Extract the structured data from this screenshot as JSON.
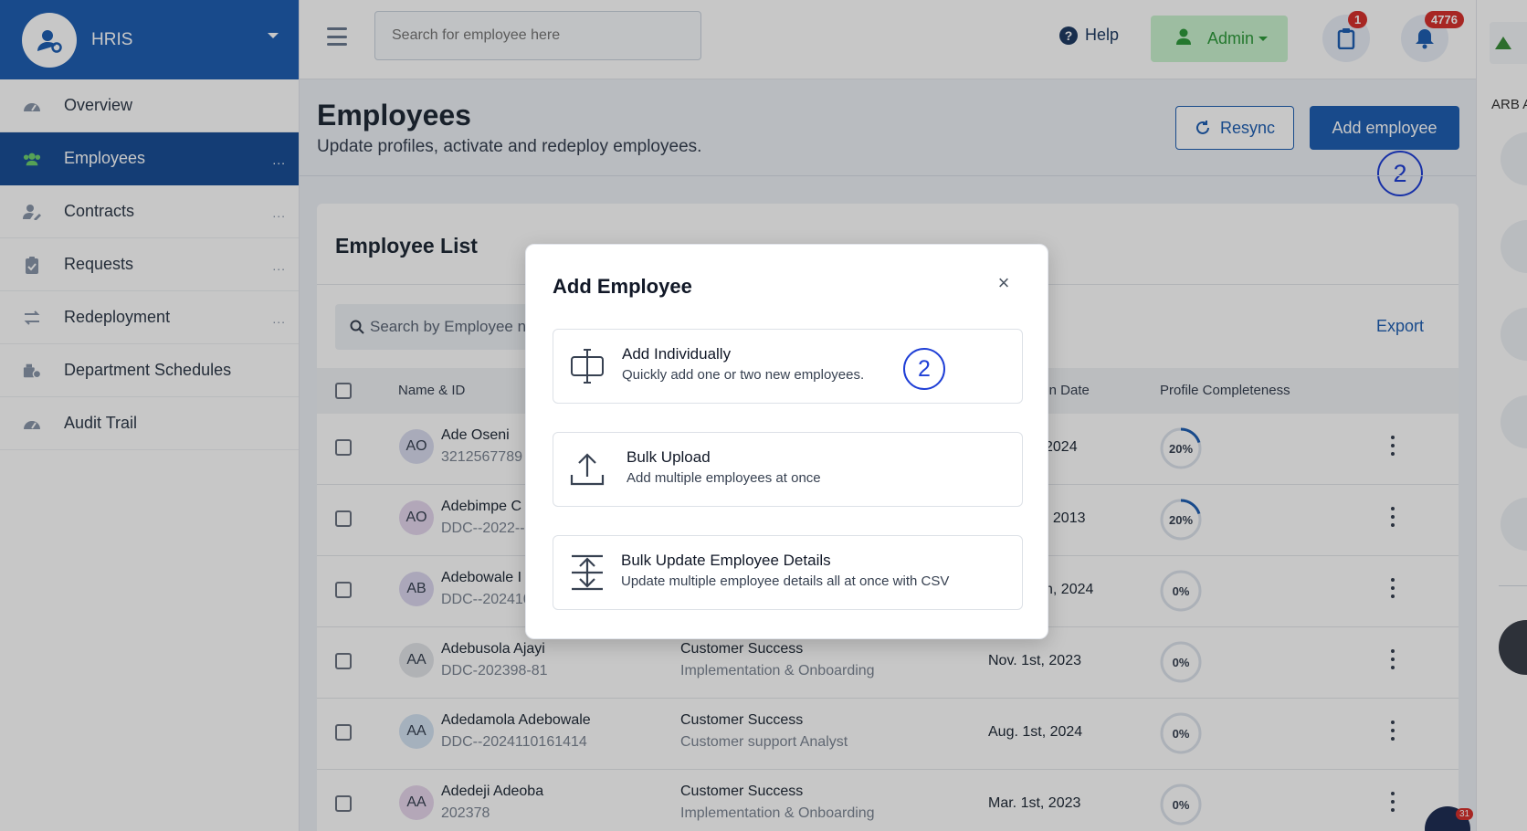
{
  "app": {
    "name": "HRIS"
  },
  "sidebar": {
    "items": [
      {
        "label": "Overview",
        "icon": "gauge-icon"
      },
      {
        "label": "Employees",
        "icon": "users-icon",
        "more": "..."
      },
      {
        "label": "Contracts",
        "icon": "user-edit-icon",
        "more": "..."
      },
      {
        "label": "Requests",
        "icon": "clipboard-icon",
        "more": "..."
      },
      {
        "label": "Redeployment",
        "icon": "arrows-icon",
        "more": "..."
      },
      {
        "label": "Department Schedules",
        "icon": "building-clock-icon"
      },
      {
        "label": "Audit Trail",
        "icon": "gauge-icon"
      }
    ]
  },
  "topbar": {
    "search_placeholder": "Search for employee here",
    "help_label": "Help",
    "admin_label": "Admin",
    "clipboard_badge": "1",
    "notification_badge": "4776"
  },
  "right_rail": {
    "org_text": "ARB A"
  },
  "page": {
    "title": "Employees",
    "subtitle": "Update profiles, activate and redeploy employees.",
    "resync_label": "Resync",
    "add_label": "Add employee",
    "step_marker": "2"
  },
  "list": {
    "title": "Employee List",
    "search_placeholder": "Search by Employee na",
    "export_label": "Export",
    "columns": [
      "Name & ID",
      "ion Date",
      "Profile Completeness"
    ],
    "rows": [
      {
        "initials": "AO",
        "name": "Ade Oseni",
        "id": "3212567789",
        "dept": "",
        "role": "",
        "date": "2024",
        "progress": "20%",
        "avatar_color": "#d9dcef"
      },
      {
        "initials": "AO",
        "name": "Adebimpe C",
        "id": "DDC--2022--",
        "dept": "",
        "role": "",
        "date": ", 2013",
        "progress": "20%",
        "avatar_color": "#e4d6ee"
      },
      {
        "initials": "AB",
        "name": "Adebowale I",
        "id": "DDC--202410",
        "dept": "",
        "role": "",
        "date": "n, 2024",
        "progress": "0%",
        "avatar_color": "#dcd7ef"
      },
      {
        "initials": "AA",
        "name": "Adebusola Ajayi",
        "id": "DDC-202398-81",
        "dept": "Customer Success",
        "role": "Implementation & Onboarding",
        "date": "Nov. 1st, 2023",
        "progress": "0%",
        "avatar_color": "#e2e4e8"
      },
      {
        "initials": "AA",
        "name": "Adedamola Adebowale",
        "id": "DDC--2024110161414",
        "dept": "Customer Success",
        "role": "Customer support Analyst",
        "date": "Aug. 1st, 2024",
        "progress": "0%",
        "avatar_color": "#d4e3f2"
      },
      {
        "initials": "AA",
        "name": "Adedeji Adeoba",
        "id": "202378",
        "dept": "Customer Success",
        "role": "Implementation & Onboarding",
        "date": "Mar. 1st, 2023",
        "progress": "0%",
        "avatar_color": "#e7d6ec"
      }
    ]
  },
  "modal": {
    "title": "Add Employee",
    "options": [
      {
        "title": "Add Individually",
        "desc": "Quickly add one or two new employees.",
        "icon": "text-cursor-icon",
        "step_marker": "2"
      },
      {
        "title": "Bulk Upload",
        "desc": "Add multiple employees at once",
        "icon": "upload-icon"
      },
      {
        "title": "Bulk Update Employee Details",
        "desc": "Update multiple employee details all at once with CSV",
        "icon": "expand-vertical-icon"
      }
    ]
  },
  "chat": {
    "badge": "31"
  },
  "colors": {
    "brand": "#1f5fb3",
    "active_nav": "#1a4f96",
    "admin_green": "#2f9a3c",
    "badge_red": "#d7312e",
    "step_marker": "#1f3fd6"
  }
}
